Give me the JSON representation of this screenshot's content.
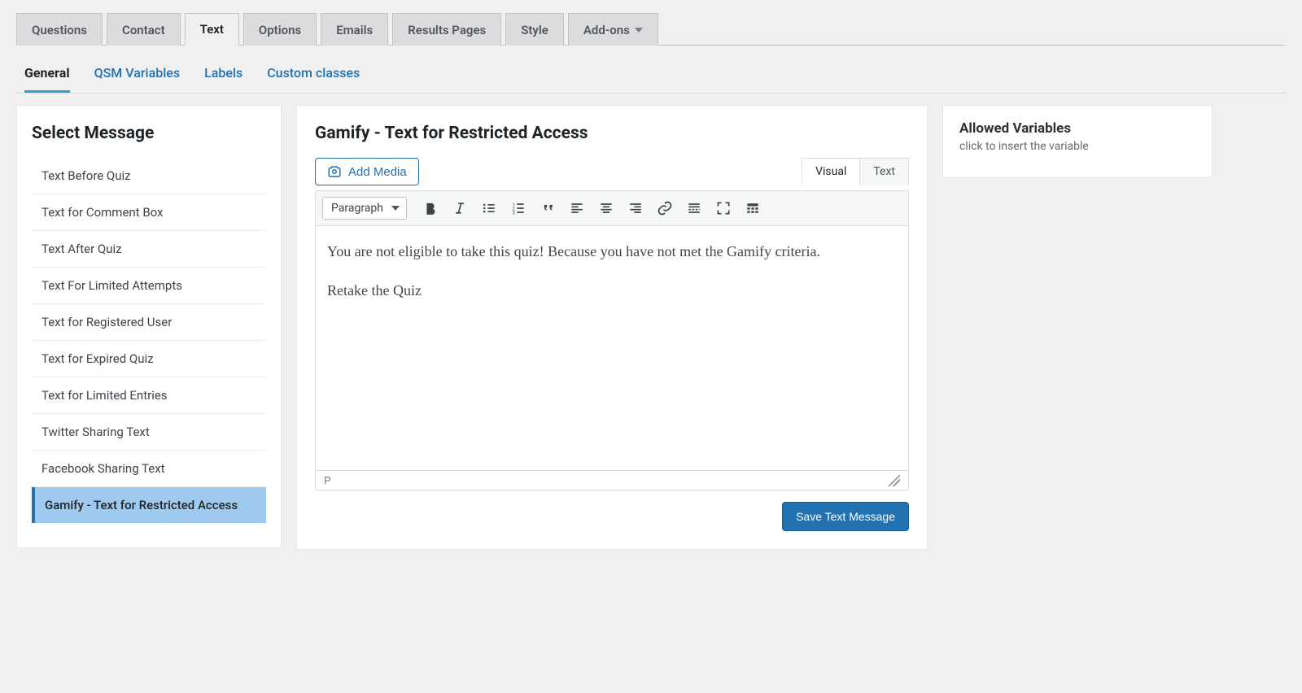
{
  "tabs": {
    "items": [
      {
        "label": "Questions"
      },
      {
        "label": "Contact"
      },
      {
        "label": "Text"
      },
      {
        "label": "Options"
      },
      {
        "label": "Emails"
      },
      {
        "label": "Results Pages"
      },
      {
        "label": "Style"
      },
      {
        "label": "Add-ons"
      }
    ],
    "active_index": 2
  },
  "sub_tabs": {
    "items": [
      {
        "label": "General"
      },
      {
        "label": "QSM Variables"
      },
      {
        "label": "Labels"
      },
      {
        "label": "Custom classes"
      }
    ],
    "active_index": 0
  },
  "left": {
    "title": "Select Message",
    "items": [
      {
        "label": "Text Before Quiz"
      },
      {
        "label": "Text for Comment Box"
      },
      {
        "label": "Text After Quiz"
      },
      {
        "label": "Text For Limited Attempts"
      },
      {
        "label": "Text for Registered User"
      },
      {
        "label": "Text for Expired Quiz"
      },
      {
        "label": "Text for Limited Entries"
      },
      {
        "label": "Twitter Sharing Text"
      },
      {
        "label": "Facebook Sharing Text"
      },
      {
        "label": "Gamify - Text for Restricted Access"
      }
    ],
    "active_index": 9
  },
  "center": {
    "title": "Gamify - Text for Restricted Access",
    "add_media_label": "Add Media",
    "editor_tabs": {
      "visual": "Visual",
      "text": "Text",
      "active": "visual"
    },
    "format_label": "Paragraph",
    "content_p1": "You are not eligible to take this quiz! Because you have not met the Gamify criteria.",
    "content_p2": "Retake the Quiz",
    "status_path": "P",
    "save_label": "Save Text Message"
  },
  "right": {
    "title": "Allowed Variables",
    "subtitle": "click to insert the variable"
  },
  "toolbar_icons": [
    "bold",
    "italic",
    "bullet-list",
    "numbered-list",
    "quote",
    "align-left",
    "align-center",
    "align-right",
    "link",
    "more",
    "fullscreen",
    "toolbar-toggle"
  ]
}
